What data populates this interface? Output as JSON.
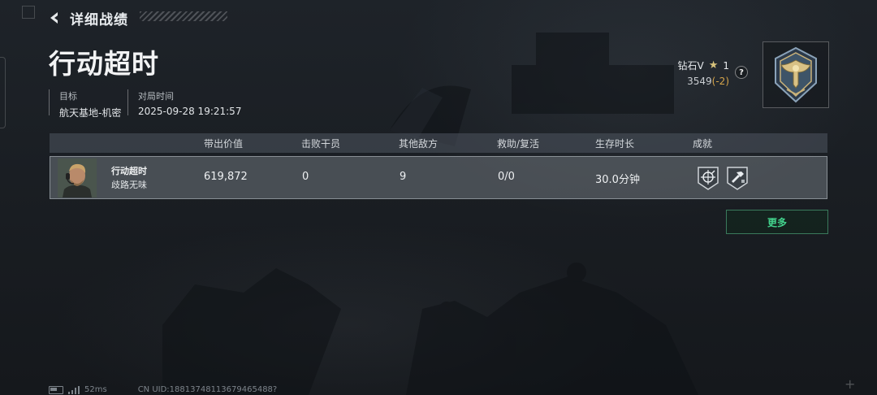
{
  "header": {
    "back_title": "详细战绩",
    "result_title": "行动超时"
  },
  "meta": {
    "target_label": "目标",
    "target_value": "航天基地-机密",
    "time_label": "对局时间",
    "time_value": "2025-09-28 19:21:57"
  },
  "rank": {
    "tier": "钻石V",
    "stars": "1",
    "score": "3549",
    "delta": "(-2)",
    "help": "?",
    "accent_color": "#d6a54a"
  },
  "table": {
    "headers": [
      "带出价值",
      "击败干员",
      "其他敌方",
      "救助/复活",
      "生存时长",
      "成就"
    ],
    "row": {
      "name": "行动超时",
      "subtitle": "歧路无味",
      "value": "619,872",
      "kills": "0",
      "other_enemies": "9",
      "assists": "0/0",
      "survival": "30.0分钟",
      "achievements": [
        "crosshair-shield-icon",
        "hammer-badge-icon"
      ]
    }
  },
  "more_button": "更多",
  "footer": {
    "ping": "52ms",
    "uid": "CN UID:18813748113679465488?"
  }
}
